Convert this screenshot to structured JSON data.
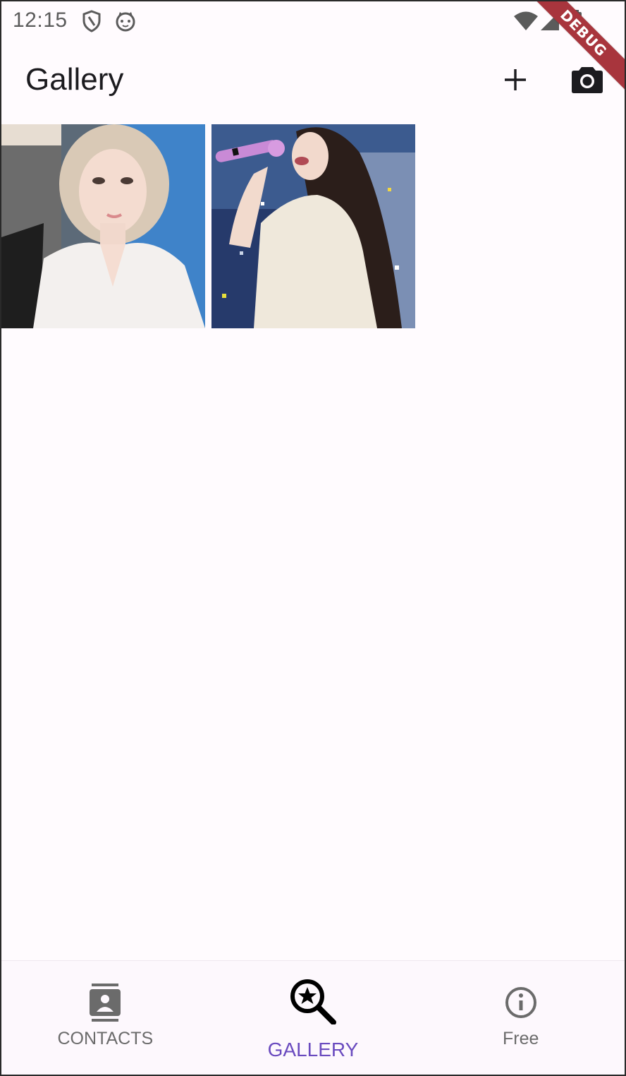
{
  "status_bar": {
    "time": "12:15",
    "icons": [
      "shield-icon",
      "cat-face-icon",
      "wifi-icon",
      "cellular-signal-icon",
      "battery-icon"
    ]
  },
  "app_bar": {
    "title": "Gallery",
    "actions": [
      "add-icon",
      "camera-icon"
    ]
  },
  "debug_banner": {
    "label": "DEBUG"
  },
  "gallery": {
    "photos": [
      {
        "name": "photo-1"
      },
      {
        "name": "photo-2"
      }
    ]
  },
  "bottom_nav": {
    "items": [
      {
        "label": "CONTACTS",
        "icon": "contacts-icon",
        "active": false
      },
      {
        "label": "GALLERY",
        "icon": "image-search-icon",
        "active": true
      },
      {
        "label": "Free",
        "icon": "info-icon",
        "active": false
      }
    ],
    "active_color": "#6a4bbf",
    "inactive_color": "#6b6b6b"
  },
  "colors": {
    "background": "#fffbfe",
    "debug_banner": "#a8353d",
    "text_primary": "#1c1b1f"
  }
}
